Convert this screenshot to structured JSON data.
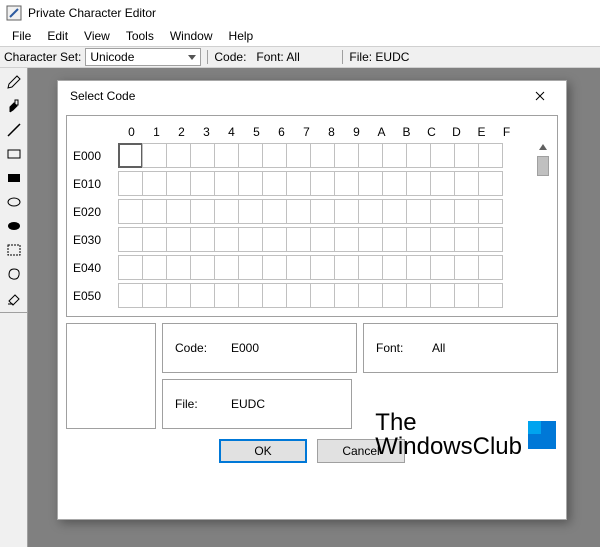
{
  "window": {
    "title": "Private Character Editor"
  },
  "menu": {
    "items": [
      "File",
      "Edit",
      "View",
      "Tools",
      "Window",
      "Help"
    ]
  },
  "infobar": {
    "charset_label": "Character Set:",
    "charset_value": "Unicode",
    "code_label": "Code:",
    "font_label": "Font: All",
    "file_label": "File: EUDC"
  },
  "dialog": {
    "title": "Select Code",
    "columns": [
      "0",
      "1",
      "2",
      "3",
      "4",
      "5",
      "6",
      "7",
      "8",
      "9",
      "A",
      "B",
      "C",
      "D",
      "E",
      "F"
    ],
    "rows": [
      "E000",
      "E010",
      "E020",
      "E030",
      "E040",
      "E050"
    ],
    "selected": {
      "row": "E000",
      "col": "0"
    },
    "code_label": "Code:",
    "code_value": "E000",
    "font_label": "Font:",
    "font_value": "All",
    "file_label": "File:",
    "file_value": "EUDC",
    "ok": "OK",
    "cancel": "Cancel"
  },
  "watermark": {
    "line1": "The",
    "line2": "WindowsClub"
  }
}
